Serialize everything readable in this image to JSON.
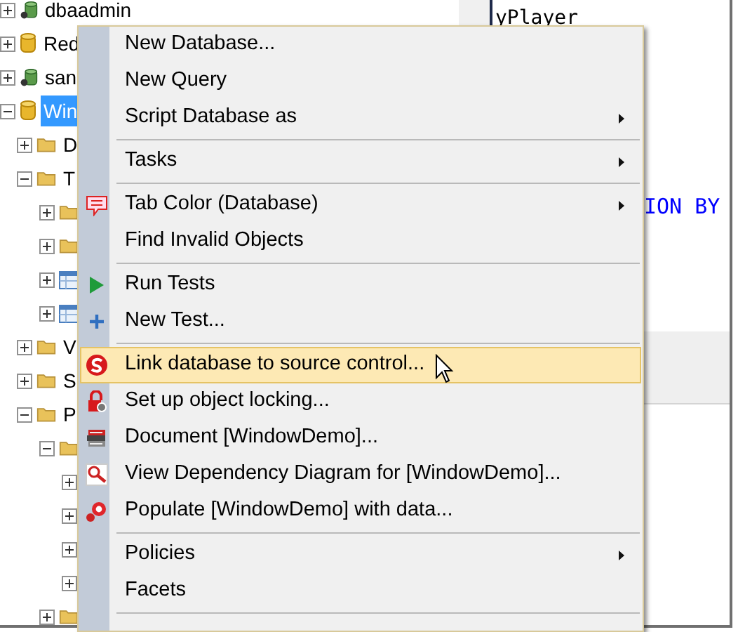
{
  "tree": [
    {
      "label": "dbaadmin",
      "kind": "db_linked",
      "expanded": false,
      "selected": false
    },
    {
      "label": "Red",
      "kind": "db",
      "expanded": false,
      "selected": false
    },
    {
      "label": "san",
      "kind": "db_linked",
      "expanded": false,
      "selected": false
    },
    {
      "label": "Win",
      "kind": "db",
      "expanded": true,
      "selected": true,
      "children": [
        {
          "label": "D",
          "kind": "folder",
          "expanded": false,
          "selected": false
        },
        {
          "label": "T",
          "kind": "folder",
          "expanded": true,
          "selected": false,
          "children": [
            {
              "kind": "folder",
              "expanded": false
            },
            {
              "kind": "folder",
              "expanded": false
            },
            {
              "kind": "table",
              "expanded": false
            },
            {
              "kind": "table",
              "expanded": false
            }
          ]
        },
        {
          "label": "V",
          "kind": "folder",
          "expanded": false,
          "selected": false
        },
        {
          "label": "S",
          "kind": "folder",
          "expanded": false,
          "selected": false
        },
        {
          "label": "P",
          "kind": "folder",
          "expanded": true,
          "selected": false,
          "children": [
            {
              "kind": "folder",
              "expanded": true,
              "children": [
                {
                  "expanded": false
                },
                {
                  "expanded": false
                },
                {
                  "expanded": false
                },
                {
                  "expanded": false
                }
              ]
            },
            {
              "kind": "folder",
              "expanded": false
            }
          ]
        }
      ]
    }
  ],
  "editor": {
    "partial_identifier": "yPlayer",
    "partial_keyword": "ION BY"
  },
  "context_menu": {
    "entries": [
      {
        "kind": "item",
        "label": "New Database...",
        "submenu": false,
        "selected": false
      },
      {
        "kind": "item",
        "label": "New Query",
        "submenu": false,
        "selected": false
      },
      {
        "kind": "item",
        "label": "Script Database as",
        "submenu": true,
        "selected": false
      },
      {
        "kind": "separator"
      },
      {
        "kind": "item",
        "label": "Tasks",
        "submenu": true,
        "selected": false
      },
      {
        "kind": "separator"
      },
      {
        "kind": "item",
        "label": "Tab Color (Database)",
        "submenu": true,
        "selected": false
      },
      {
        "kind": "item",
        "label": "Find Invalid Objects",
        "submenu": false,
        "selected": false
      },
      {
        "kind": "separator"
      },
      {
        "kind": "item",
        "label": "Run Tests",
        "submenu": false,
        "selected": false
      },
      {
        "kind": "item",
        "label": "New Test...",
        "submenu": false,
        "selected": false
      },
      {
        "kind": "separator"
      },
      {
        "kind": "item",
        "label": "Link database to source control...",
        "submenu": false,
        "selected": true
      },
      {
        "kind": "item",
        "label": "Set up object locking...",
        "submenu": false,
        "selected": false
      },
      {
        "kind": "item",
        "label": "Document [WindowDemo]...",
        "submenu": false,
        "selected": false
      },
      {
        "kind": "item",
        "label": "View Dependency Diagram for [WindowDemo]...",
        "submenu": false,
        "selected": false
      },
      {
        "kind": "item",
        "label": "Populate [WindowDemo] with data...",
        "submenu": false,
        "selected": false
      },
      {
        "kind": "separator"
      },
      {
        "kind": "item",
        "label": "Policies",
        "submenu": true,
        "selected": false
      },
      {
        "kind": "item",
        "label": "Facets",
        "submenu": false,
        "selected": false
      },
      {
        "kind": "separator"
      }
    ]
  }
}
